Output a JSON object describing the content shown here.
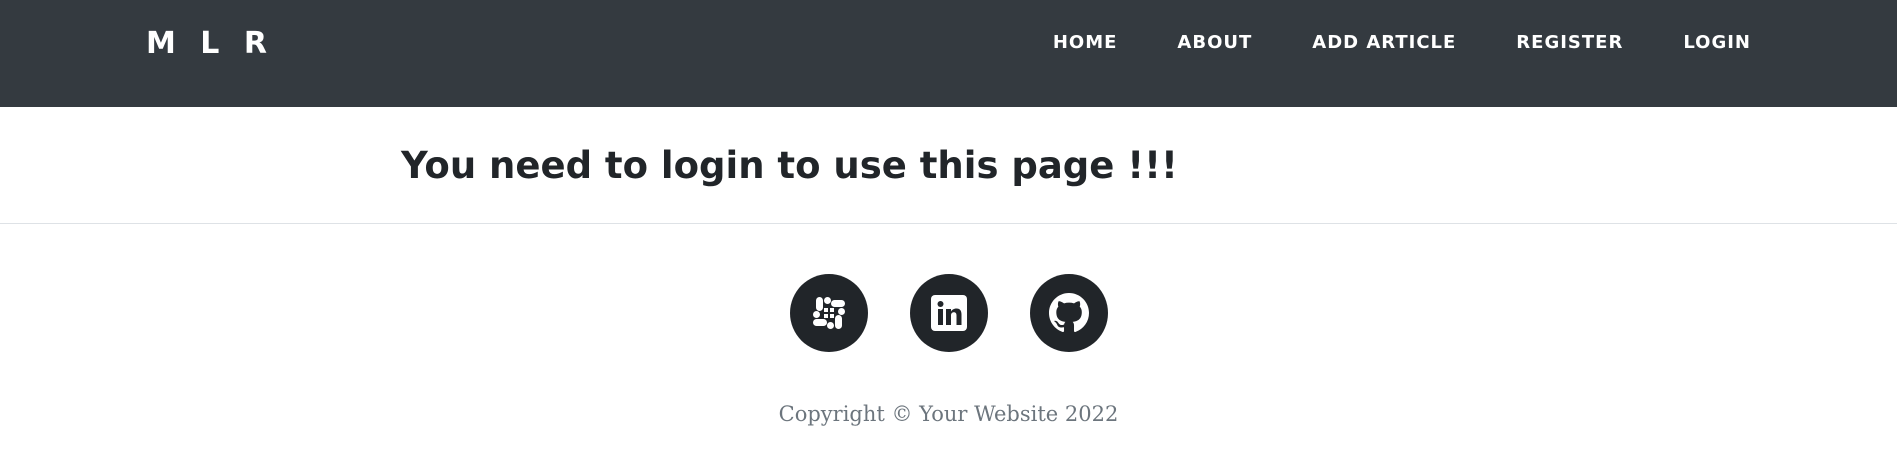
{
  "navbar": {
    "brand": "M L R",
    "links": [
      {
        "label": "HOME"
      },
      {
        "label": "ABOUT"
      },
      {
        "label": "ADD ARTICLE"
      },
      {
        "label": "REGISTER"
      },
      {
        "label": "LOGIN"
      }
    ],
    "background": "#343a40"
  },
  "main": {
    "message": "You need to login to use this page !!!"
  },
  "footer": {
    "social": [
      {
        "icon": "slack-icon"
      },
      {
        "icon": "linkedin-icon"
      },
      {
        "icon": "github-icon"
      }
    ],
    "copyright": "Copyright © Your Website 2022"
  }
}
